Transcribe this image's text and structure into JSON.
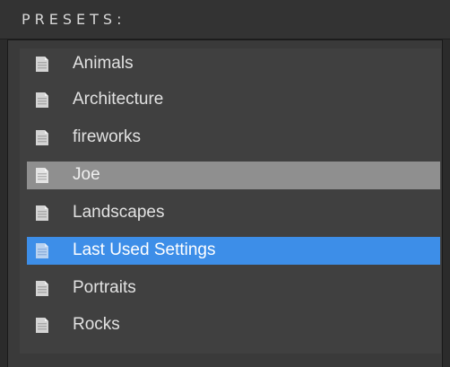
{
  "panel": {
    "title": "PRESETS:"
  },
  "presets": {
    "items": [
      {
        "label": "Animals",
        "icon": "document-icon",
        "state": "normal"
      },
      {
        "label": "Architecture",
        "icon": "document-icon",
        "state": "normal"
      },
      {
        "label": "fireworks",
        "icon": "document-icon",
        "state": "normal"
      },
      {
        "label": "Joe",
        "icon": "document-icon",
        "state": "highlighted"
      },
      {
        "label": "Landscapes",
        "icon": "document-icon",
        "state": "normal"
      },
      {
        "label": "Last Used Settings",
        "icon": "document-icon",
        "state": "selected"
      },
      {
        "label": "Portraits",
        "icon": "document-icon",
        "state": "normal"
      },
      {
        "label": "Rocks",
        "icon": "document-icon",
        "state": "normal"
      }
    ]
  },
  "colors": {
    "background": "#2b2b2b",
    "list_background": "#404040",
    "highlight_gray": "#8f8f8f",
    "selection_blue": "#3d8ee8",
    "text": "#e2e2e2"
  }
}
